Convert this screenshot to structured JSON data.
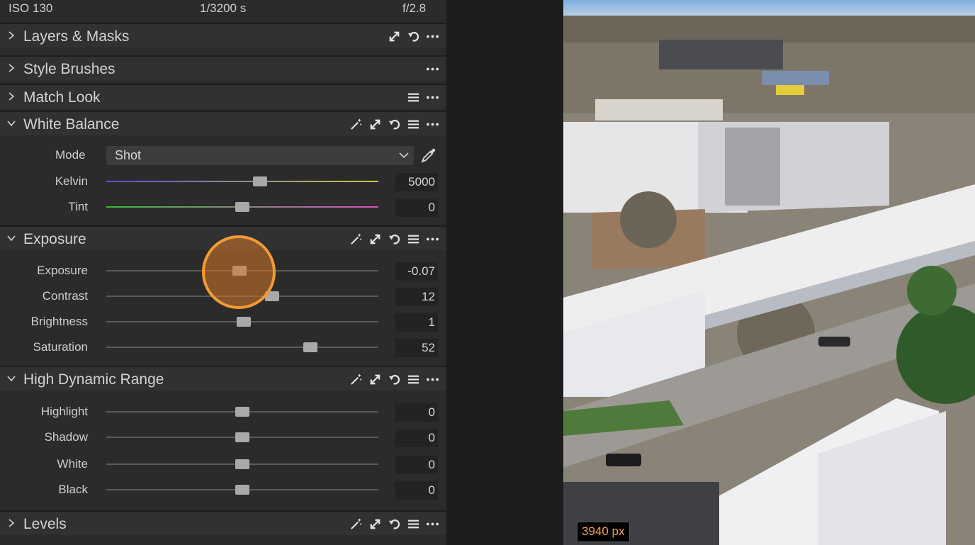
{
  "info": {
    "iso": "ISO 130",
    "shutter": "1/3200 s",
    "aperture": "f/2.8"
  },
  "tools": {
    "layers": {
      "title": "Layers & Masks"
    },
    "style_brushes": {
      "title": "Style Brushes"
    },
    "match_look": {
      "title": "Match Look"
    },
    "white_balance": {
      "title": "White Balance",
      "mode_label": "Mode",
      "mode_value": "Shot",
      "kelvin": {
        "label": "Kelvin",
        "value": "5000",
        "level": 0.565
      },
      "tint": {
        "label": "Tint",
        "value": "0",
        "level": 0.5
      }
    },
    "exposure": {
      "title": "Exposure",
      "sliders": [
        {
          "label": "Exposure",
          "value": "-0.07",
          "level": 0.49
        },
        {
          "label": "Contrast",
          "value": "12",
          "level": 0.61
        },
        {
          "label": "Brightness",
          "value": "1",
          "level": 0.505
        },
        {
          "label": "Saturation",
          "value": "52",
          "level": 0.75
        }
      ]
    },
    "hdr": {
      "title": "High Dynamic Range",
      "sliders": [
        {
          "label": "Highlight",
          "value": "0",
          "level": 0.5
        },
        {
          "label": "Shadow",
          "value": "0",
          "level": 0.5
        },
        {
          "label": "White",
          "value": "0",
          "level": 0.5
        },
        {
          "label": "Black",
          "value": "0",
          "level": 0.5
        }
      ]
    },
    "levels": {
      "title": "Levels"
    }
  },
  "viewer": {
    "size_badge": "3940 px"
  },
  "colors": {
    "accent_orange": "#f39a35",
    "kelvin_gradient": [
      "#5b4fd6",
      "#c9c545"
    ],
    "tint_gradient": [
      "#38b83a",
      "#d34fbf"
    ]
  }
}
